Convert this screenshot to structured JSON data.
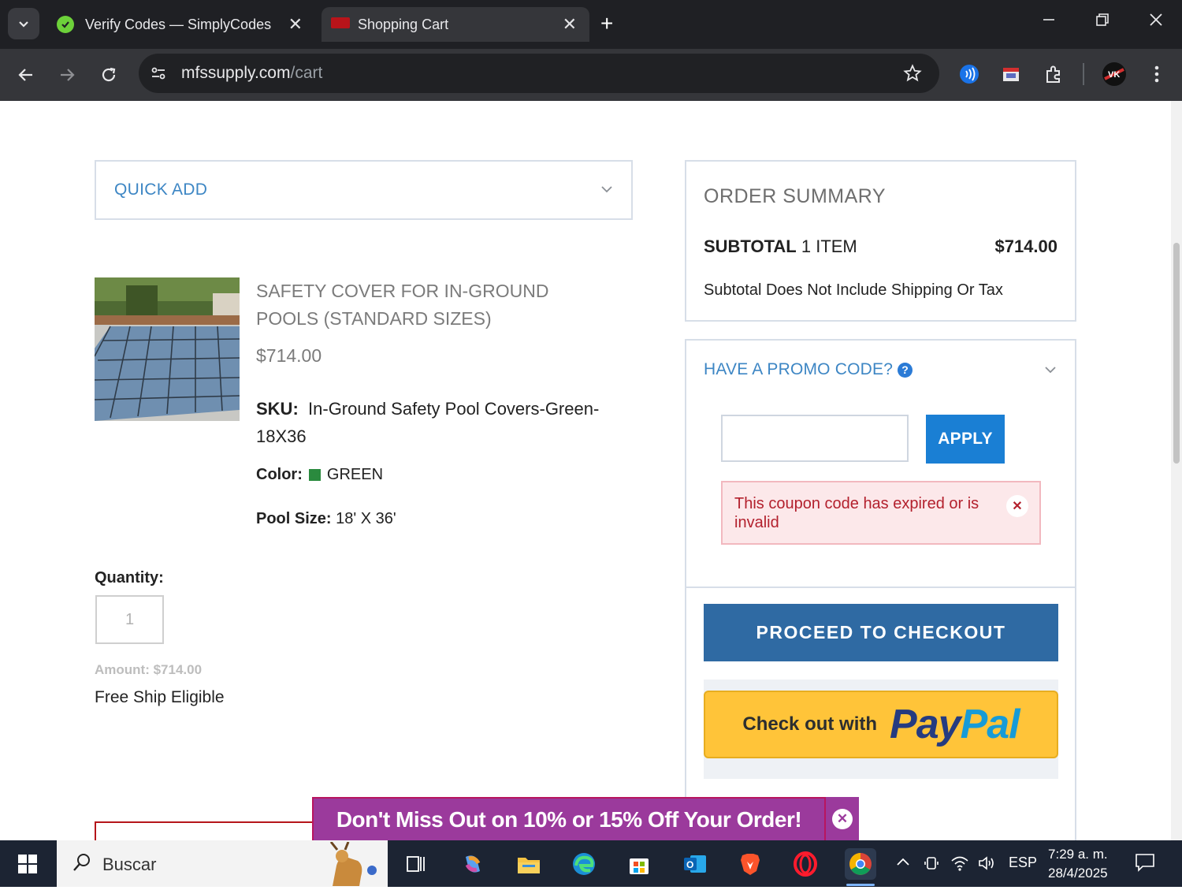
{
  "browser": {
    "tabs": [
      {
        "title": "Verify Codes — SimplyCodes"
      },
      {
        "title": "Shopping Cart"
      }
    ],
    "url_host": "mfssupply.com",
    "url_path": "/cart"
  },
  "quick_add": {
    "label": "QUICK ADD"
  },
  "product": {
    "title": "SAFETY COVER FOR IN-GROUND POOLS (STANDARD SIZES)",
    "price": "$714.00",
    "sku_label": "SKU:",
    "sku_value": "In-Ground Safety Pool Covers-Green-18X36",
    "color_label": "Color:",
    "color_value": "GREEN",
    "color_hex": "#2a8a3e",
    "pool_size_label": "Pool Size:",
    "pool_size_value": "18' X 36'",
    "quantity_label": "Quantity:",
    "quantity_value": "1",
    "amount": "Amount: $714.00",
    "shipping": "Free Ship Eligible"
  },
  "order_summary": {
    "heading": "ORDER SUMMARY",
    "subtotal_label": "SUBTOTAL",
    "item_count": "1 ITEM",
    "subtotal_value": "$714.00",
    "note": "Subtotal Does Not Include Shipping Or Tax"
  },
  "promo": {
    "heading": "HAVE A PROMO CODE?",
    "input_value": "",
    "apply_label": "APPLY",
    "error_message": "This coupon code has expired or is invalid"
  },
  "checkout": {
    "proceed_label": "PROCEED TO CHECKOUT",
    "paypal_prefix": "Check out with",
    "paypal_brand_1": "Pay",
    "paypal_brand_2": "Pal"
  },
  "banner": {
    "text": "Don't Miss Out on 10% or 15% Off Your Order!"
  },
  "taskbar": {
    "search_label": "Buscar",
    "language": "ESP",
    "time": "7:29 a. m.",
    "date": "28/4/2025"
  },
  "colors": {
    "accent_blue": "#3d86c4",
    "checkout_blue": "#2f6aa3",
    "apply_blue": "#1a7fd4",
    "paypal_yellow": "#ffc439",
    "error_red": "#b3202d",
    "banner_purple": "#9b3a9c"
  }
}
